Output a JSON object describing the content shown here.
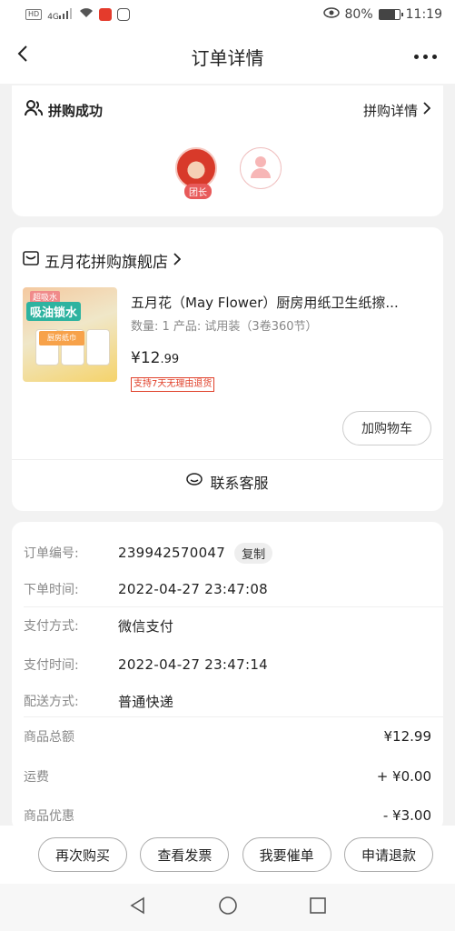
{
  "status_bar": {
    "network_badge": "HD",
    "signal_label": "4G",
    "battery_percent": "80%",
    "battery_level": 0.8,
    "time": "11:19"
  },
  "header": {
    "title": "订单详情"
  },
  "group_buy": {
    "status": "拼购成功",
    "details_link": "拼购详情",
    "leader_badge": "团长"
  },
  "store": {
    "name": "五月花拼购旗舰店"
  },
  "product": {
    "name": "五月花（May Flower）厨房用纸卫生纸擦...",
    "spec": "数量: 1  产品: 试用装（3卷360节）",
    "price_symbol": "¥",
    "price_int": "12",
    "price_cents": ".99",
    "tag": "支持7天无理由退货",
    "image_banner": "吸油锁水",
    "image_top_label": "超吸水",
    "image_pack_label": "厨房纸巾",
    "add_to_cart": "加购物车"
  },
  "service": {
    "contact": "联系客服"
  },
  "order_info": {
    "order_no_label": "订单编号:",
    "order_no": "239942570047",
    "copy": "复制",
    "order_time_label": "下单时间:",
    "order_time": "2022-04-27 23:47:08",
    "pay_method_label": "支付方式:",
    "pay_method": "微信支付",
    "pay_time_label": "支付时间:",
    "pay_time": "2022-04-27 23:47:14",
    "delivery_label": "配送方式:",
    "delivery": "普通快递",
    "total_label": "商品总额",
    "total": "¥12.99",
    "shipping_label": "运费",
    "shipping": "+ ¥0.00",
    "discount_label": "商品优惠",
    "discount": "- ¥3.00"
  },
  "actions": {
    "rebuy": "再次购买",
    "invoice": "查看发票",
    "urge": "我要催单",
    "refund": "申请退款"
  },
  "colors": {
    "accent_red": "#e0402a",
    "background": "#f2f2f2"
  }
}
